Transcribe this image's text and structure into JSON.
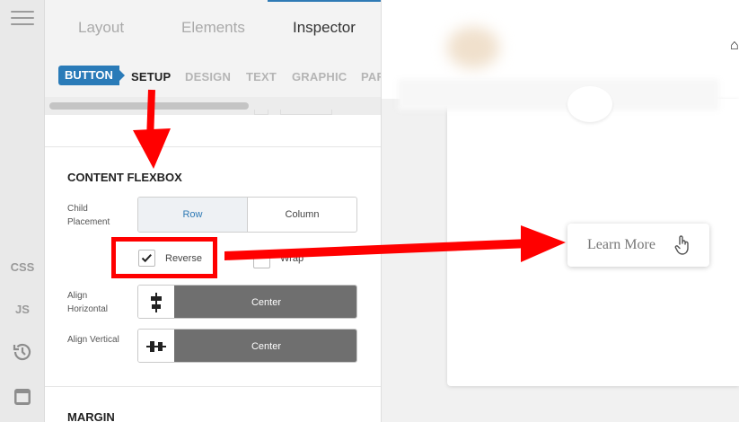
{
  "rail": {
    "css_label": "CSS",
    "js_label": "JS",
    "icons": [
      "menu-icon",
      "history-icon",
      "window-icon"
    ]
  },
  "tabs": {
    "layout": "Layout",
    "elements": "Elements",
    "inspector": "Inspector",
    "active": "Inspector"
  },
  "subtabs": {
    "badge": "BUTTON",
    "setup": "SETUP",
    "design": "DESIGN",
    "text": "TEXT",
    "graphic": "GRAPHIC",
    "partial": "PAR"
  },
  "content_flexbox": {
    "title": "CONTENT FLEXBOX",
    "child_placement_label": "Child Placement",
    "options": [
      "Row",
      "Column"
    ],
    "selected": "Row",
    "reverse_label": "Reverse",
    "reverse_checked": true,
    "wrap_label": "Wrap",
    "wrap_checked": false,
    "align_horizontal_label": "Align Horizontal",
    "align_horizontal_value": "Center",
    "align_vertical_label": "Align Vertical",
    "align_vertical_value": "Center"
  },
  "margin": {
    "title": "MARGIN"
  },
  "canvas": {
    "button_text": "Learn More"
  },
  "colors": {
    "accent": "#2a7bb8",
    "annotation": "#ff0000",
    "dropdown_bg": "#6f6f6f"
  }
}
